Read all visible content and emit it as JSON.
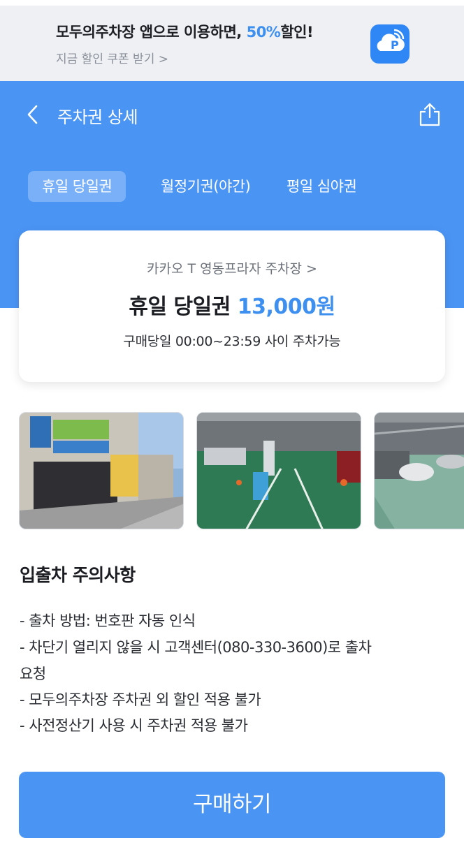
{
  "promo": {
    "title_prefix": "모두의주차장 앱으로 이용하면, ",
    "title_accent": "50%",
    "title_suffix": "할인!",
    "coupon_link": "지금 할인 쿠폰 받기 >",
    "app_icon": "moduparking-app-icon"
  },
  "header": {
    "back_icon": "chevron-left-icon",
    "title": "주차권 상세",
    "share_icon": "share-icon"
  },
  "tabs": [
    {
      "label": "휴일 당일권",
      "active": true
    },
    {
      "label": "월정기권(야간)",
      "active": false
    },
    {
      "label": "평일 심야권",
      "active": false
    }
  ],
  "ticket": {
    "lot_name": "카카오 T 영동프라자 주차장 >",
    "name": "휴일 당일권 ",
    "price": "13,000원",
    "hours": "구매당일 00:00~23:59 사이 주차가능"
  },
  "photos": [
    "parking-entrance-photo",
    "parking-gate-photo",
    "parking-interior-photo"
  ],
  "notices": {
    "title": "입출차 주의사항",
    "lines": [
      "- 출차 방법: 번호판 자동 인식",
      "- 차단기 열리지 않을 시 고객센터(080-330-3600)로 출차",
      "요청",
      "- 모두의주차장 주차권 외 할인 적용 불가",
      "- 사전정산기 사용 시 주차권 적용 불가"
    ]
  },
  "buy_label": "구매하기",
  "colors": {
    "primary": "#4a94f4",
    "accent": "#3d8ff0",
    "active_tab": "#79b0f7",
    "promo_bg": "#eef0f4"
  }
}
